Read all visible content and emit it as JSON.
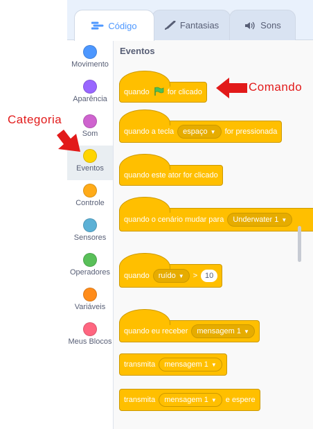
{
  "tabs": [
    {
      "label": "Código",
      "icon": "code-icon",
      "active": true
    },
    {
      "label": "Fantasias",
      "icon": "brush-icon",
      "active": false
    },
    {
      "label": "Sons",
      "icon": "speaker-icon",
      "active": false
    }
  ],
  "categories": [
    {
      "label": "Movimento",
      "color": "#4c97ff"
    },
    {
      "label": "Aparência",
      "color": "#9966ff"
    },
    {
      "label": "Som",
      "color": "#cf63cf"
    },
    {
      "label": "Eventos",
      "color": "#ffd500"
    },
    {
      "label": "Controle",
      "color": "#ffab19"
    },
    {
      "label": "Sensores",
      "color": "#5cb1d6"
    },
    {
      "label": "Operadores",
      "color": "#59c059"
    },
    {
      "label": "Variáveis",
      "color": "#ff8c1a"
    },
    {
      "label": "Meus Blocos",
      "color": "#ff6680"
    }
  ],
  "palette": {
    "title": "Eventos",
    "blocks": {
      "flag_clicked": {
        "pre": "quando",
        "post": "for clicado"
      },
      "key_pressed": {
        "pre": "quando a tecla",
        "value": "espaço",
        "post": "for pressionada"
      },
      "sprite_clicked": {
        "text": "quando este ator for clicado"
      },
      "backdrop_switch": {
        "pre": "quando o cenário mudar para",
        "value": "Underwater 1"
      },
      "greater_than": {
        "pre": "quando",
        "value": "ruído",
        "op": ">",
        "number": "10"
      },
      "receive": {
        "pre": "quando eu receber",
        "value": "mensagem 1"
      },
      "broadcast": {
        "pre": "transmita",
        "value": "mensagem 1"
      },
      "broadcast_wait": {
        "pre": "transmita",
        "value": "mensagem 1",
        "post": "e espere"
      }
    }
  },
  "annotations": {
    "comando": "Comando",
    "categoria": "Categoria"
  }
}
